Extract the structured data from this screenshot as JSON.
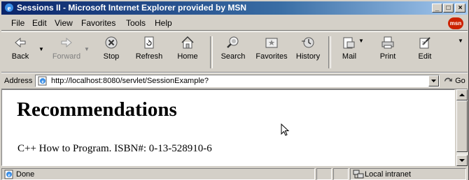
{
  "window": {
    "title": "Sessions II - Microsoft Internet Explorer provided by MSN",
    "controls": [
      "_",
      "□",
      "×"
    ]
  },
  "menu": {
    "items": [
      "File",
      "Edit",
      "View",
      "Favorites",
      "Tools",
      "Help"
    ],
    "logo": "msn"
  },
  "toolbar": {
    "buttons": [
      {
        "label": "Back",
        "icon": "back-arrow-icon"
      },
      {
        "label": "Forward",
        "icon": "forward-arrow-icon",
        "disabled": true
      },
      {
        "label": "Stop",
        "icon": "stop-icon"
      },
      {
        "label": "Refresh",
        "icon": "refresh-icon"
      },
      {
        "label": "Home",
        "icon": "home-icon"
      },
      {
        "label": "Search",
        "icon": "search-icon"
      },
      {
        "label": "Favorites",
        "icon": "favorites-icon"
      },
      {
        "label": "History",
        "icon": "history-icon"
      },
      {
        "label": "Mail",
        "icon": "mail-icon"
      },
      {
        "label": "Print",
        "icon": "print-icon"
      },
      {
        "label": "Edit",
        "icon": "edit-icon"
      }
    ]
  },
  "address": {
    "label": "Address",
    "url": "http://localhost:8080/servlet/SessionExample?",
    "go_label": "Go"
  },
  "page": {
    "heading": "Recommendations",
    "text": "C++ How to Program. ISBN#: 0-13-528910-6"
  },
  "status": {
    "text": "Done",
    "zone": "Local intranet"
  },
  "colors": {
    "titlebar_start": "#0a246a",
    "titlebar_end": "#a6caf0",
    "chrome": "#d4d0c8",
    "msn_red": "#cc2200"
  }
}
